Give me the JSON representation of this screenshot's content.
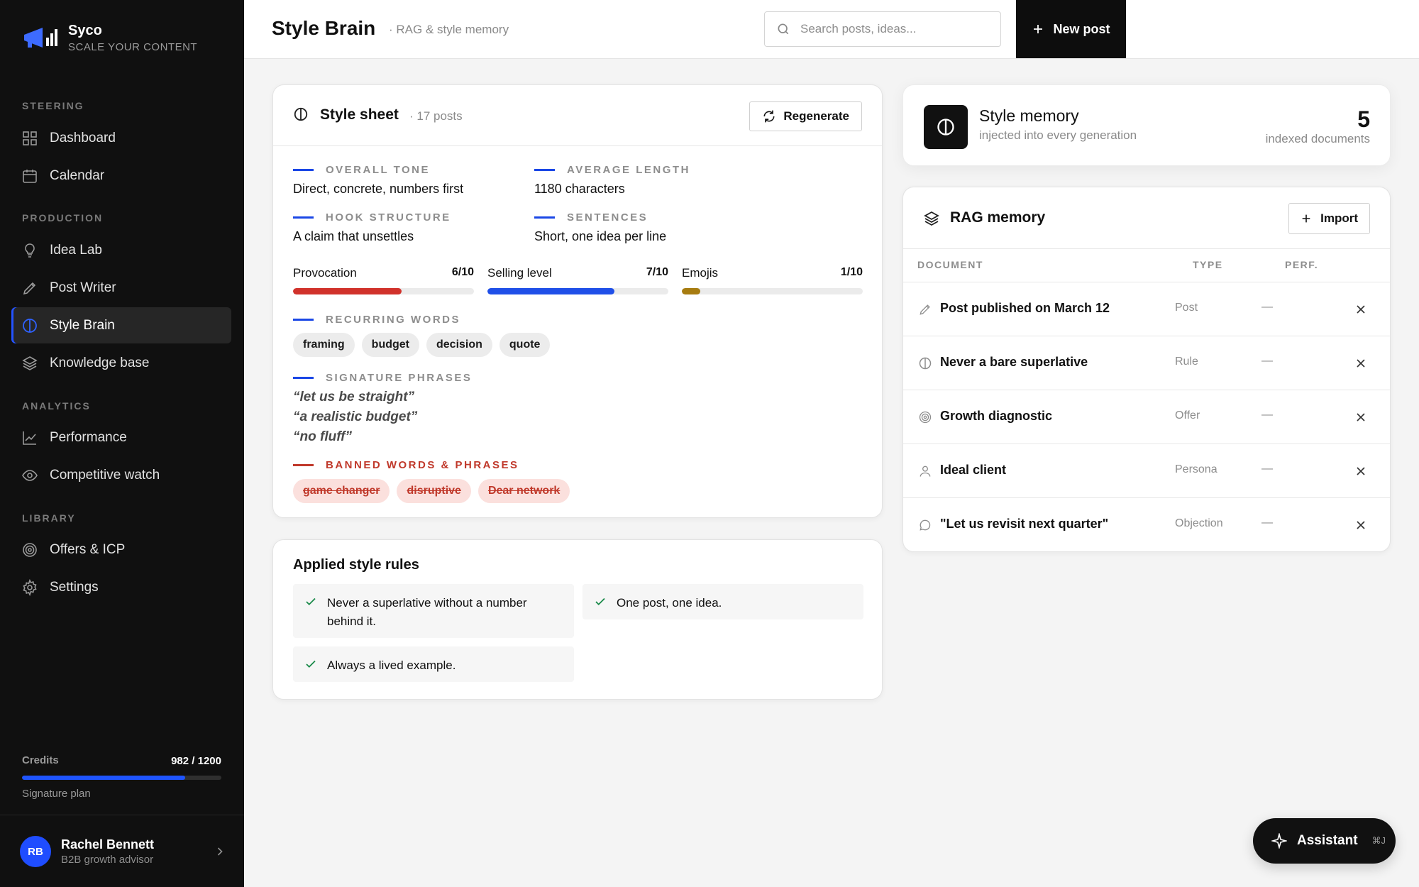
{
  "brand": {
    "name": "Syco",
    "tagline": "SCALE YOUR CONTENT"
  },
  "sidebar": {
    "sections": [
      {
        "title": "STEERING"
      },
      {
        "title": "PRODUCTION"
      },
      {
        "title": "ANALYTICS"
      },
      {
        "title": "LIBRARY"
      }
    ],
    "items": [
      {
        "label": "Dashboard",
        "icon": "grid-icon"
      },
      {
        "label": "Calendar",
        "icon": "calendar-icon"
      },
      {
        "label": "Idea Lab",
        "icon": "lightbulb-icon"
      },
      {
        "label": "Post Writer",
        "icon": "pencil-icon"
      },
      {
        "label": "Style Brain",
        "icon": "brain-icon",
        "active": true
      },
      {
        "label": "Knowledge base",
        "icon": "layers-icon"
      },
      {
        "label": "Performance",
        "icon": "chart-line-icon"
      },
      {
        "label": "Competitive watch",
        "icon": "eye-icon"
      },
      {
        "label": "Offers & ICP",
        "icon": "target-icon"
      },
      {
        "label": "Settings",
        "icon": "gear-icon"
      }
    ],
    "credits": {
      "label": "Credits",
      "value": "982 / 1200",
      "used": 982,
      "total": 1200,
      "plan": "Signature plan"
    },
    "user": {
      "initials": "RB",
      "name": "Rachel Bennett",
      "role": "B2B growth advisor"
    }
  },
  "header": {
    "title": "Style Brain",
    "subtitle": "· RAG & style memory",
    "search_placeholder": "Search posts, ideas...",
    "new_post_label": "New post"
  },
  "style_sheet": {
    "title": "Style sheet",
    "count": "· 17 posts",
    "regenerate_label": "Regenerate",
    "attributes": {
      "tone": {
        "label": "OVERALL TONE",
        "value": "Direct, concrete, numbers first"
      },
      "length": {
        "label": "AVERAGE LENGTH",
        "value": "1180 characters"
      },
      "hook": {
        "label": "HOOK STRUCTURE",
        "value": "A claim that unsettles"
      },
      "sentences": {
        "label": "SENTENCES",
        "value": "Short, one idea per line"
      }
    },
    "meters": [
      {
        "label": "Provocation",
        "value_text": "6/10",
        "value": 6,
        "max": 10,
        "color": "#d1322b"
      },
      {
        "label": "Selling level",
        "value_text": "7/10",
        "value": 7,
        "max": 10,
        "color": "#1f4fe8"
      },
      {
        "label": "Emojis",
        "value_text": "1/10",
        "value": 1,
        "max": 10,
        "color": "#a77c10"
      }
    ],
    "recurring_words": {
      "label": "RECURRING WORDS",
      "words": [
        "framing",
        "budget",
        "decision",
        "quote"
      ]
    },
    "signature_phrases": {
      "label": "SIGNATURE PHRASES",
      "phrases": [
        "“let us be straight”",
        "“a realistic budget”",
        "“no fluff”"
      ]
    },
    "banned": {
      "label": "BANNED WORDS & PHRASES",
      "words": [
        "game changer",
        "disruptive",
        "Dear network"
      ]
    }
  },
  "rules": {
    "title": "Applied style rules",
    "items": [
      "Never a superlative without a number behind it.",
      "One post, one idea.",
      "Always a lived example."
    ]
  },
  "style_memory": {
    "title": "Style memory",
    "subtitle": "injected into every generation",
    "count": "5",
    "count_label": "indexed documents"
  },
  "rag": {
    "title": "RAG memory",
    "import_label": "Import",
    "columns": {
      "document": "DOCUMENT",
      "type": "TYPE",
      "perf": "PERF."
    },
    "rows": [
      {
        "doc": "Post published on March 12",
        "type": "Post",
        "perf": "—",
        "icon": "pencil-icon"
      },
      {
        "doc": "Never a bare superlative",
        "type": "Rule",
        "perf": "—",
        "icon": "brain-icon"
      },
      {
        "doc": "Growth diagnostic",
        "type": "Offer",
        "perf": "—",
        "icon": "target-icon"
      },
      {
        "doc": "Ideal client",
        "type": "Persona",
        "perf": "—",
        "icon": "user-icon"
      },
      {
        "doc": "\"Let us revisit next quarter\"",
        "type": "Objection",
        "perf": "—",
        "icon": "chat-bubble-icon"
      }
    ]
  },
  "assistant": {
    "label": "Assistant",
    "shortcut": "⌘J"
  }
}
